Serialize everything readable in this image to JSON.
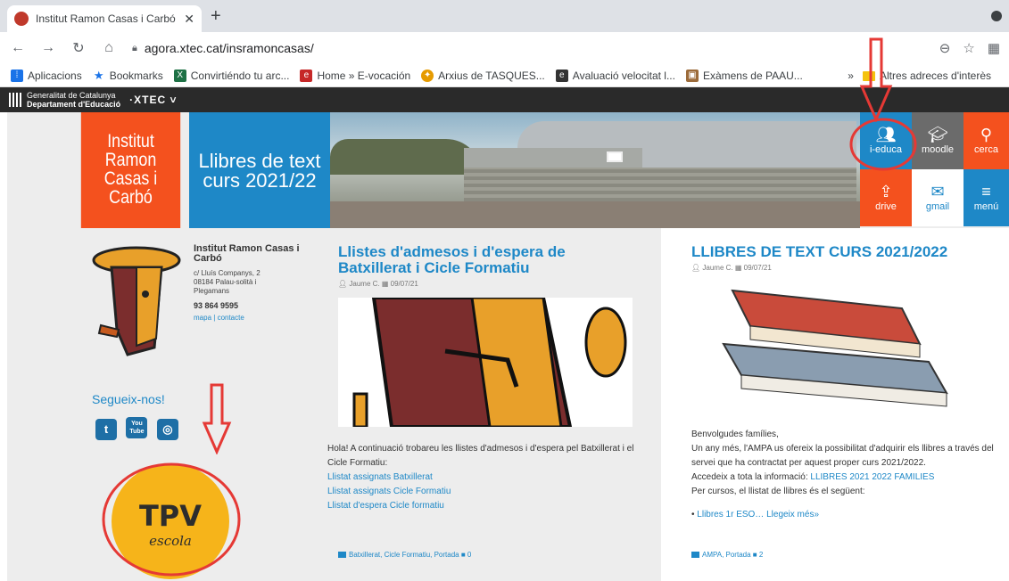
{
  "browser": {
    "tab_title": "Institut Ramon Casas i Carbó | Llib",
    "new_tab": "+",
    "url": "agora.xtec.cat/insramoncasas/",
    "bookmarks": [
      {
        "label": "Aplicacions",
        "icon": "apps-grid-icon",
        "color": "#1a73e8"
      },
      {
        "label": "Bookmarks",
        "icon": "star-icon",
        "color": "#1a73e8"
      },
      {
        "label": "Convirtiéndo tu arc...",
        "icon": "excel-icon",
        "color": "#1e7145"
      },
      {
        "label": "Home » E-vocación",
        "icon": "e-icon",
        "color": "#c62828"
      },
      {
        "label": "Arxius de TASQUES...",
        "icon": "shell-icon",
        "color": "#e69b00"
      },
      {
        "label": "Avaluació velocitat l...",
        "icon": "e-dark-icon",
        "color": "#333333"
      },
      {
        "label": "Exàmens de PAAU...",
        "icon": "uni-icon",
        "color": "#9c6b3a"
      }
    ],
    "bookmarks_more": "»",
    "other_bookmarks": "Altres adreces d'interès"
  },
  "gencat": {
    "line1": "Generalitat de Catalunya",
    "line2": "Departament d'Educació",
    "xtec": "·XTEC"
  },
  "header": {
    "institut_label": "Institut Ramon Casas i Carbó",
    "libres_label": "Llibres de text curs 2021/22",
    "tiles": [
      {
        "label": "i-educa",
        "icon": "people-icon",
        "color": "#1e88c7"
      },
      {
        "label": "moodle",
        "icon": "graduation-cap-icon",
        "color": "#6b6b6b"
      },
      {
        "label": "cerca",
        "icon": "search-icon",
        "color": "#f4511e"
      },
      {
        "label": "drive",
        "icon": "share-icon",
        "color": "#f4511e"
      },
      {
        "label": "gmail",
        "icon": "mail-icon",
        "color": "#ffffff"
      },
      {
        "label": "menú",
        "icon": "menu-icon",
        "color": "#1e88c7"
      }
    ]
  },
  "sidebar": {
    "school_name": "Institut Ramon Casas i Carbó",
    "address1": "c/ Lluís Companys, 2",
    "address2": "08184 Palau-solità i Plegamans",
    "phone": "93 864 9595",
    "map_link": "mapa",
    "separator": "|",
    "contact_link": "contacte",
    "follow": "Segueix-nos!",
    "social": [
      {
        "label": "t",
        "icon": "twitter-icon"
      },
      {
        "label": "You Tube",
        "icon": "youtube-icon"
      },
      {
        "label": "◎",
        "icon": "instagram-icon"
      }
    ],
    "tpv_title": "TPV",
    "tpv_sub": "escola"
  },
  "post1": {
    "title": "Llistes d'admesos i d'espera de Batxillerat i Cicle Formatiu",
    "author": "Jaume C.",
    "date": "09/07/21",
    "intro": "Hola! A continuació trobareu les llistes d'admesos i d'espera pel Batxillerat i el Cicle Formatiu:",
    "links": [
      "Llistat assignats Batxillerat",
      "Llistat assignats Cicle Formatiu",
      "Llistat d'espera Cicle formatiu"
    ],
    "categories": "Batxillerat, Cicle Formatiu, Portada",
    "comments": "0"
  },
  "post2": {
    "title": "LLIBRES DE TEXT CURS 2021/2022",
    "author": "Jaume C.",
    "date": "09/07/21",
    "greeting": "Benvolgudes famílies,",
    "p1": "Un any més, l'AMPA us ofereix la possibilitat d'adquirir els llibres a través del servei que ha contractat per aquest proper curs 2021/2022.",
    "p2_prefix": "Accedeix a tota la informació:",
    "p2_link": "LLIBRES 2021 2022 FAMILIES",
    "p3": "Per cursos, el llistat de llibres és el següent:",
    "bullet": "Llibres 1r ESO…",
    "read_more": "Llegeix més»",
    "categories": "AMPA, Portada",
    "comments": "2"
  }
}
